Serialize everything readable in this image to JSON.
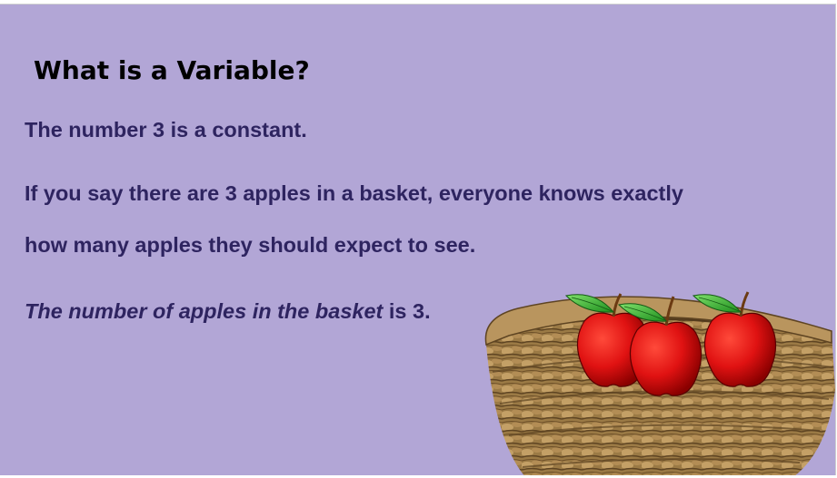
{
  "slide": {
    "title": "What is a Variable?",
    "paragraph1": "The number 3 is a constant.",
    "paragraph2_line1": "If you say there are 3 apples in a basket, everyone knows exactly",
    "paragraph2_line2": "how many apples they should expect to see.",
    "paragraph3_italic": "The number of apples in the basket",
    "paragraph3_rest": " is 3."
  },
  "illustration": {
    "apples_count": 3,
    "icon": "apple-basket-illustration"
  },
  "colors": {
    "background": "#b2a6d6",
    "text": "#2e2460",
    "title": "#000000",
    "apple": "#d81010",
    "leaf": "#2fb52f",
    "basket": "#8a6a3a"
  }
}
